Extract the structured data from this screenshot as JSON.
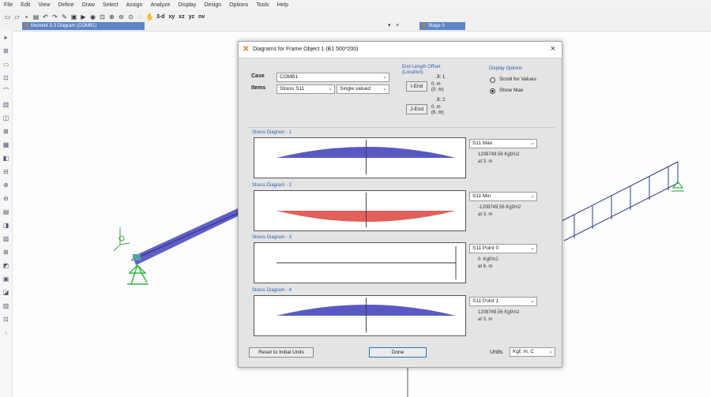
{
  "menu": [
    "File",
    "Edit",
    "View",
    "Define",
    "Draw",
    "Select",
    "Assign",
    "Analyze",
    "Display",
    "Design",
    "Options",
    "Tools",
    "Help"
  ],
  "toolbar": {
    "view_labels": [
      "3-d",
      "xy",
      "xz",
      "yz",
      "nv"
    ],
    "icons": [
      "new-file",
      "open-folder",
      "save",
      "print",
      "undo",
      "redo",
      "pencil",
      "lock",
      "run",
      "run-analysis",
      "zoom-window",
      "zoom-in",
      "zoom-out",
      "zoom-full",
      "zoom-previous",
      "pan"
    ]
  },
  "tabs": [
    {
      "label": "Moment 3-3 Diagram (COMB1)"
    },
    {
      "label": "Stage 0"
    }
  ],
  "tab_controls": {
    "dropdown": "▾",
    "close": "×"
  },
  "dialog": {
    "title": "Diagrams for Frame Object 1  (B1 500*200)",
    "close": "×",
    "case_label": "Case",
    "case_value": "COMB1",
    "items_label": "Items",
    "items_value": "Stress S11",
    "items_mode": "Single valued",
    "end_offset_title": "End Length Offset (Location)",
    "iend_label": "I-End",
    "iend_info": [
      "Jt: 1",
      "0. m",
      "(0. m)"
    ],
    "jend_label": "J-End",
    "jend_info": [
      "Jt: 2",
      "0. m",
      "(6. m)"
    ],
    "display_title": "Display Options",
    "opt_scroll": "Scroll for Values",
    "opt_showmax": "Show Max",
    "selected_option": "Show Max",
    "diagrams": [
      {
        "title": "Stress Diagram - 1",
        "select": "S11 Max",
        "value": "1208749.56 Kgf/m2",
        "at": "at 3. m",
        "shape": "positive",
        "color": "#5a59c4"
      },
      {
        "title": "Stress Diagram - 2",
        "select": "S11 Min",
        "value": "-1208749.56 Kgf/m2",
        "at": "at 3. m",
        "shape": "negative",
        "color": "#e0605a"
      },
      {
        "title": "Stress Diagram - 3",
        "select": "S11 Point 0",
        "value": "0. Kgf/m2",
        "at": "at 6. m",
        "shape": "zero",
        "color": "#333333"
      },
      {
        "title": "Stress Diagram - 4",
        "select": "S11 Point 1",
        "value": "1208749.56 Kgf/m2",
        "at": "at 3. m",
        "shape": "positive",
        "color": "#5a59c4"
      }
    ],
    "reset_button": "Reset to Initial Units",
    "done_button": "Done",
    "units_label": "Units",
    "units_value": "Kgf, m, C"
  }
}
